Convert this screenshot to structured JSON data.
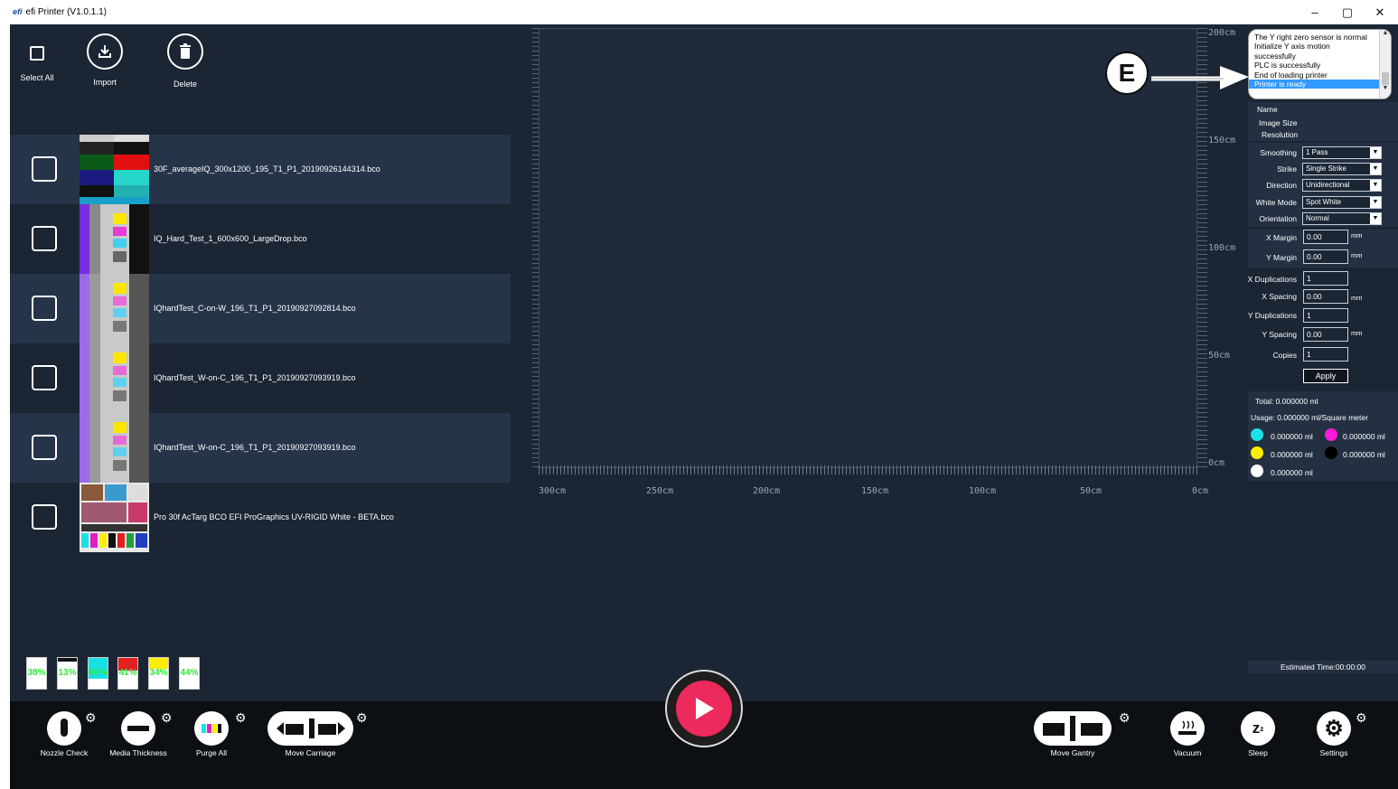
{
  "window": {
    "logo": "efi",
    "title": "efi Printer (V1.0.1.1)",
    "controls": {
      "minimize": "–",
      "restore": "▢",
      "close": "✕"
    }
  },
  "toolbar": {
    "select_all": "Select All",
    "import": "Import",
    "delete": "Delete"
  },
  "files": [
    {
      "name": "30F_averageIQ_300x1200_195_T1_P1_20190926144314.bco"
    },
    {
      "name": "IQ_Hard_Test_1_600x600_LargeDrop.bco"
    },
    {
      "name": "IQhardTest_C-on-W_196_T1_P1_20190927092814.bco"
    },
    {
      "name": "IQhardTest_W-on-C_196_T1_P1_20190927093919.bco"
    },
    {
      "name": "IQhardTest_W-on-C_196_T1_P1_20190927093919.bco"
    },
    {
      "name": "Pro 30f AcTarg BCO EFI ProGraphics UV-RIGID White - BETA.bco"
    }
  ],
  "ruler": {
    "x_labels": [
      "300cm",
      "250cm",
      "200cm",
      "150cm",
      "100cm",
      "50cm",
      "0cm"
    ],
    "y_labels": [
      "200cm",
      "150cm",
      "100cm",
      "50cm",
      "0cm"
    ]
  },
  "messages": [
    "The Y right zero sensor is normal",
    "Initialize Y axis motion",
    "successfully",
    "PLC is successfully",
    "End of loading printer",
    "Printer is ready"
  ],
  "image_info": {
    "name_label": "Name",
    "size_label": "Image Size",
    "resolution_label": "Resolution"
  },
  "settings": {
    "smoothing": {
      "label": "Smoothing",
      "value": "1 Pass"
    },
    "strike": {
      "label": "Strike",
      "value": "Single Strike"
    },
    "direction": {
      "label": "Direction",
      "value": "Unidirectional"
    },
    "white_mode": {
      "label": "White Mode",
      "value": "Spot White"
    },
    "orientation": {
      "label": "Orientation",
      "value": "Normal"
    },
    "x_margin": {
      "label": "X Margin",
      "value": "0.00",
      "unit": "mm"
    },
    "y_margin": {
      "label": "Y Margin",
      "value": "0.00",
      "unit": "mm"
    },
    "x_duplications": {
      "label": "X Duplications",
      "value": "1"
    },
    "x_spacing": {
      "label": "X Spacing",
      "value": "0.00",
      "unit": "mm"
    },
    "y_duplications": {
      "label": "Y Duplications",
      "value": "1"
    },
    "y_spacing": {
      "label": "Y Spacing",
      "value": "0.00",
      "unit": "mm"
    },
    "copies": {
      "label": "Copies",
      "value": "1"
    },
    "apply": "Apply"
  },
  "usage": {
    "total": "Total: 0.000000 ml",
    "usage": "Usage: 0.000000 ml/Square meter",
    "inks": [
      {
        "color": "#19e0e6",
        "value": "0.000000 ml"
      },
      {
        "color": "#ff1ad9",
        "value": "0.000000 ml"
      },
      {
        "color": "#ffee00",
        "value": "0.000000 ml"
      },
      {
        "color": "#000000",
        "value": "0.000000 ml"
      },
      {
        "color": "#ffffff",
        "value": "0.000000 ml"
      }
    ]
  },
  "estimated_time": "Estimated Time:00:00:00",
  "ink_levels": [
    {
      "percent": "38%",
      "fraction": 0.38,
      "color": "#ffffff"
    },
    {
      "percent": "13%",
      "fraction": 0.13,
      "color": "#111111"
    },
    {
      "percent": "67%",
      "fraction": 0.67,
      "color": "#19e0e6"
    },
    {
      "percent": "41%",
      "fraction": 0.41,
      "color": "#e52020"
    },
    {
      "percent": "34%",
      "fraction": 0.34,
      "color": "#ffee00"
    },
    {
      "percent": "44%",
      "fraction": 0.44,
      "color": "#ffffff"
    }
  ],
  "bottom_buttons": {
    "nozzle_check": "Nozzle Check",
    "media_thickness": "Media Thickness",
    "purge_all": "Purge All",
    "move_carriage": "Move Carriage",
    "move_gantry": "Move Gantry",
    "vacuum": "Vacuum",
    "sleep": "Sleep",
    "settings": "Settings"
  },
  "callout": "E"
}
